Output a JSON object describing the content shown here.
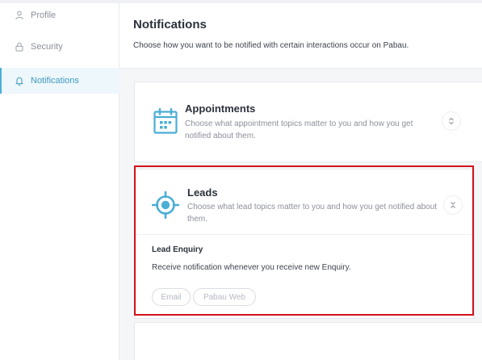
{
  "sidebar": {
    "items": [
      {
        "label": "Profile",
        "icon": "user-icon"
      },
      {
        "label": "Security",
        "icon": "lock-icon"
      },
      {
        "label": "Notifications",
        "icon": "bell-icon",
        "active": true
      }
    ]
  },
  "header": {
    "title": "Notifications",
    "subtitle": "Choose how you want to be notified with certain interactions occur on Pabau."
  },
  "cards": {
    "appointments": {
      "title": "Appointments",
      "description": "Choose what appointment topics matter to you and how you get notified about them.",
      "icon": "calendar-icon",
      "toggle_icon": "expand-icon"
    },
    "leads": {
      "title": "Leads",
      "description": "Choose what lead topics matter to you and how you get notified about them.",
      "icon": "target-icon",
      "toggle_icon": "collapse-icon",
      "section": {
        "title": "Lead Enquiry",
        "description": "Receive notification whenever you receive new Enquiry.",
        "channels": [
          {
            "label": "Email"
          },
          {
            "label": "Pabau Web"
          }
        ]
      }
    }
  },
  "colors": {
    "accent": "#4aaed5",
    "highlight": "#d0121b",
    "text": "#2c313c",
    "muted": "#8b909a"
  }
}
